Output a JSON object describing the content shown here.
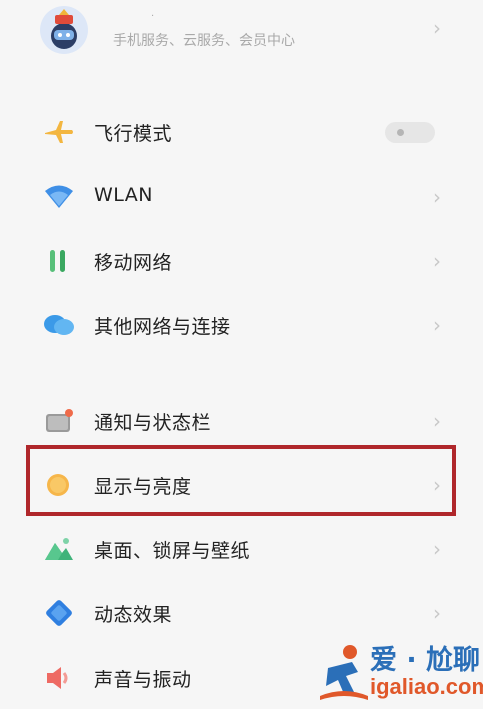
{
  "profile": {
    "name": "·",
    "subtitle": "手机服务、云服务、会员中心"
  },
  "settings": [
    {
      "label": "飞行模式",
      "icon": "airplane-icon",
      "control": "toggle",
      "toggle_on": false
    },
    {
      "label": "WLAN",
      "icon": "wifi-icon",
      "control": "chevron"
    },
    {
      "label": "移动网络",
      "icon": "mobile-network-icon",
      "control": "chevron"
    },
    {
      "label": "其他网络与连接",
      "icon": "connection-icon",
      "control": "chevron"
    },
    {
      "label": "通知与状态栏",
      "icon": "notification-icon",
      "control": "chevron"
    },
    {
      "label": "显示与亮度",
      "icon": "brightness-icon",
      "control": "chevron"
    },
    {
      "label": "桌面、锁屏与壁纸",
      "icon": "wallpaper-icon",
      "control": "chevron"
    },
    {
      "label": "动态效果",
      "icon": "motion-effects-icon",
      "control": "chevron"
    },
    {
      "label": "声音与振动",
      "icon": "sound-icon",
      "control": "chevron"
    }
  ],
  "chevron_glyph": "›",
  "highlight_color": "#b0272b",
  "watermark": {
    "line1": "爱 · 尬聊",
    "line2": "igaliao.com"
  }
}
